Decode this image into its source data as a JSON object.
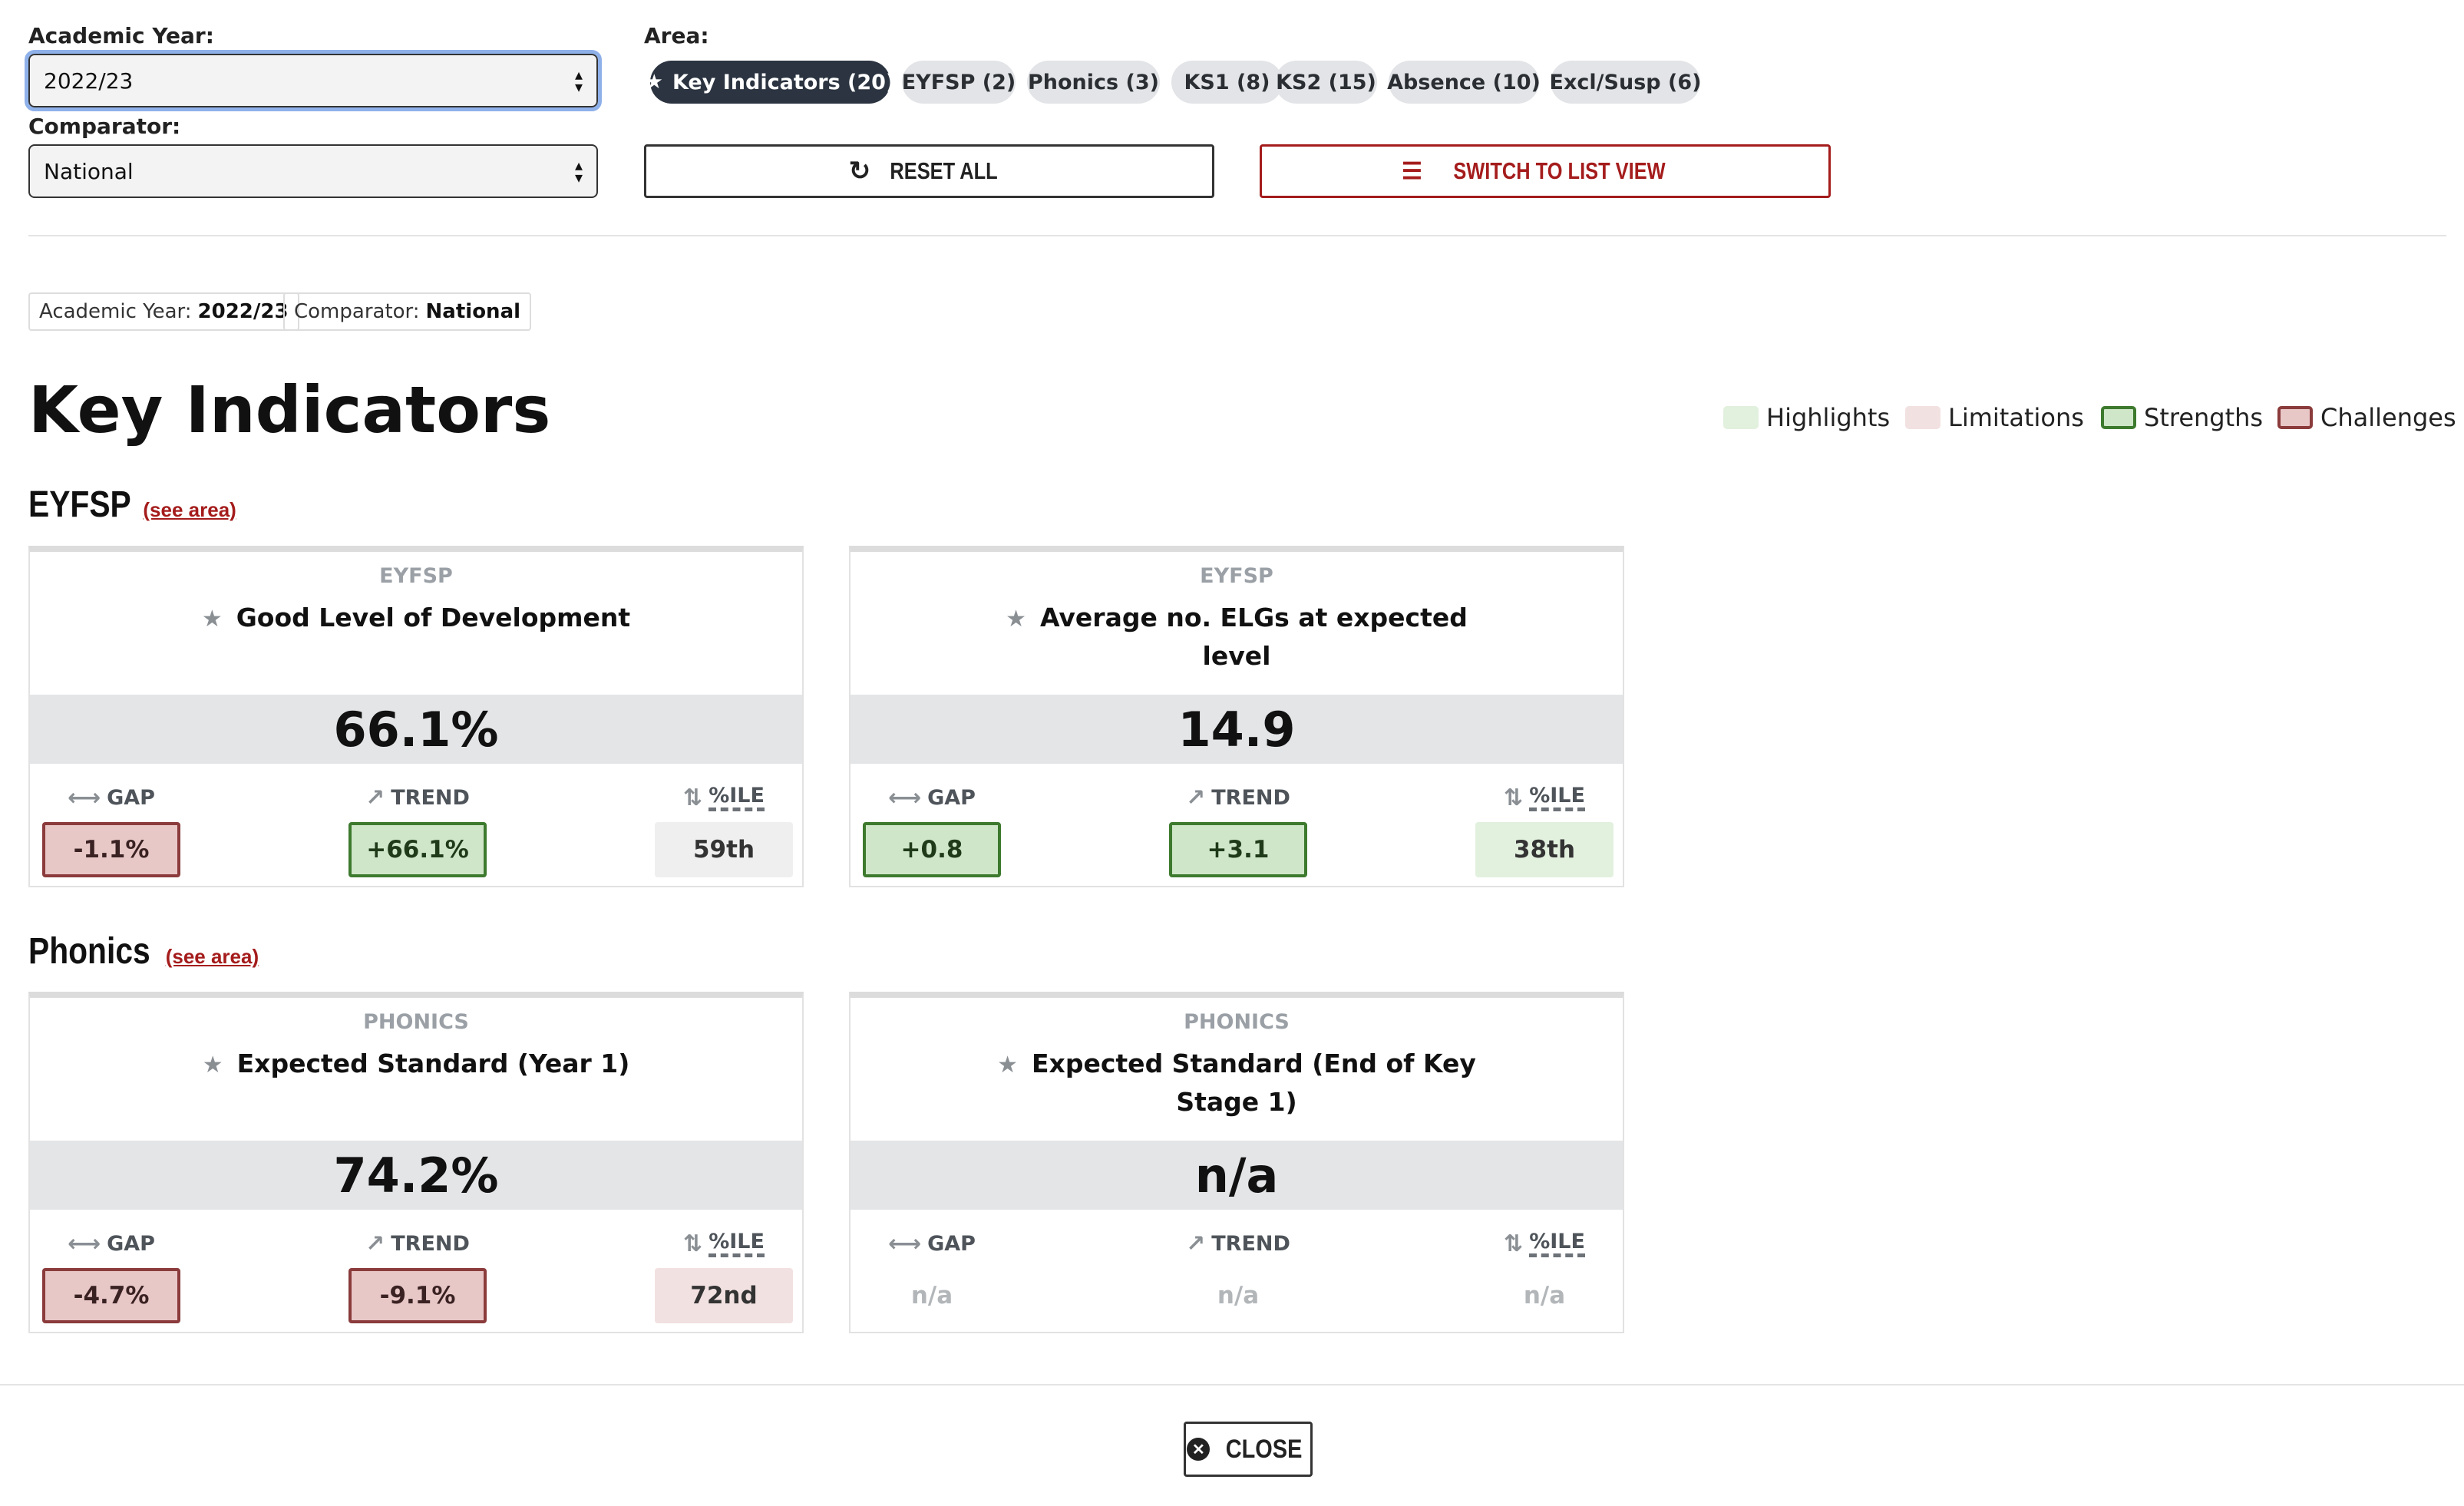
{
  "filters": {
    "academic_year_label": "Academic Year:",
    "academic_year_value": "2022/23",
    "comparator_label": "Comparator:",
    "comparator_value": "National",
    "area_label": "Area:"
  },
  "area_chips": [
    {
      "label": "Key Indicators (20)",
      "active": true
    },
    {
      "label": "EYFSP (2)",
      "active": false
    },
    {
      "label": "Phonics (3)",
      "active": false
    },
    {
      "label": "KS1 (8)",
      "active": false
    },
    {
      "label": "KS2 (15)",
      "active": false
    },
    {
      "label": "Absence (10)",
      "active": false
    },
    {
      "label": "Excl/Susp (6)",
      "active": false
    }
  ],
  "buttons": {
    "reset_label": "RESET ALL",
    "reset_icon": "refresh-icon",
    "switch_label": "SWITCH TO LIST VIEW",
    "switch_icon": "list-icon",
    "close_label": "CLOSE",
    "close_icon": "close-circle-icon"
  },
  "applied_tags": [
    {
      "key": "Academic Year:",
      "value": "2022/23"
    },
    {
      "key": "Comparator:",
      "value": "National"
    }
  ],
  "page_title": "Key Indicators",
  "legend": [
    {
      "label": "Highlights",
      "color": "#e2f0de",
      "border": "none"
    },
    {
      "label": "Limitations",
      "color": "#f2e1e1",
      "border": "none"
    },
    {
      "label": "Strengths",
      "color": "#cfe6c9",
      "border": "#3d7a2e"
    },
    {
      "label": "Challenges",
      "color": "#e8c7c7",
      "border": "#8b3b3b"
    }
  ],
  "sections": [
    {
      "title": "EYFSP",
      "link": "(see area)",
      "cards": [
        {
          "area": "EYFSP",
          "name": "Good Level of Development",
          "value": "66.1%",
          "gap_label": "GAP",
          "trend_label": "TREND",
          "pctile_label": "%ILE",
          "gap": "-1.1%",
          "trend": "+66.1%",
          "pctile": "59th"
        },
        {
          "area": "EYFSP",
          "name": "Average no. ELGs at expected level",
          "value": "14.9",
          "gap_label": "GAP",
          "trend_label": "TREND",
          "pctile_label": "%ILE",
          "gap": "+0.8",
          "trend": "+3.1",
          "pctile": "38th"
        }
      ]
    },
    {
      "title": "Phonics",
      "link": "(see area)",
      "cards": [
        {
          "area": "PHONICS",
          "name": "Expected Standard (Year 1)",
          "value": "74.2%",
          "gap_label": "GAP",
          "trend_label": "TREND",
          "pctile_label": "%ILE",
          "gap": "-4.7%",
          "trend": "-9.1%",
          "pctile": "72nd"
        },
        {
          "area": "PHONICS",
          "name": "Expected Standard (End of Key Stage 1)",
          "value": "n/a",
          "gap_label": "GAP",
          "trend_label": "TREND",
          "pctile_label": "%ILE",
          "gap": "n/a",
          "trend": "n/a",
          "pctile": "n/a"
        }
      ]
    }
  ],
  "colors": {
    "accent": "#a51c1c",
    "chip_active": "#2b3440",
    "strength_border": "#3d7a2e",
    "challenge_border": "#8b3b3b"
  }
}
